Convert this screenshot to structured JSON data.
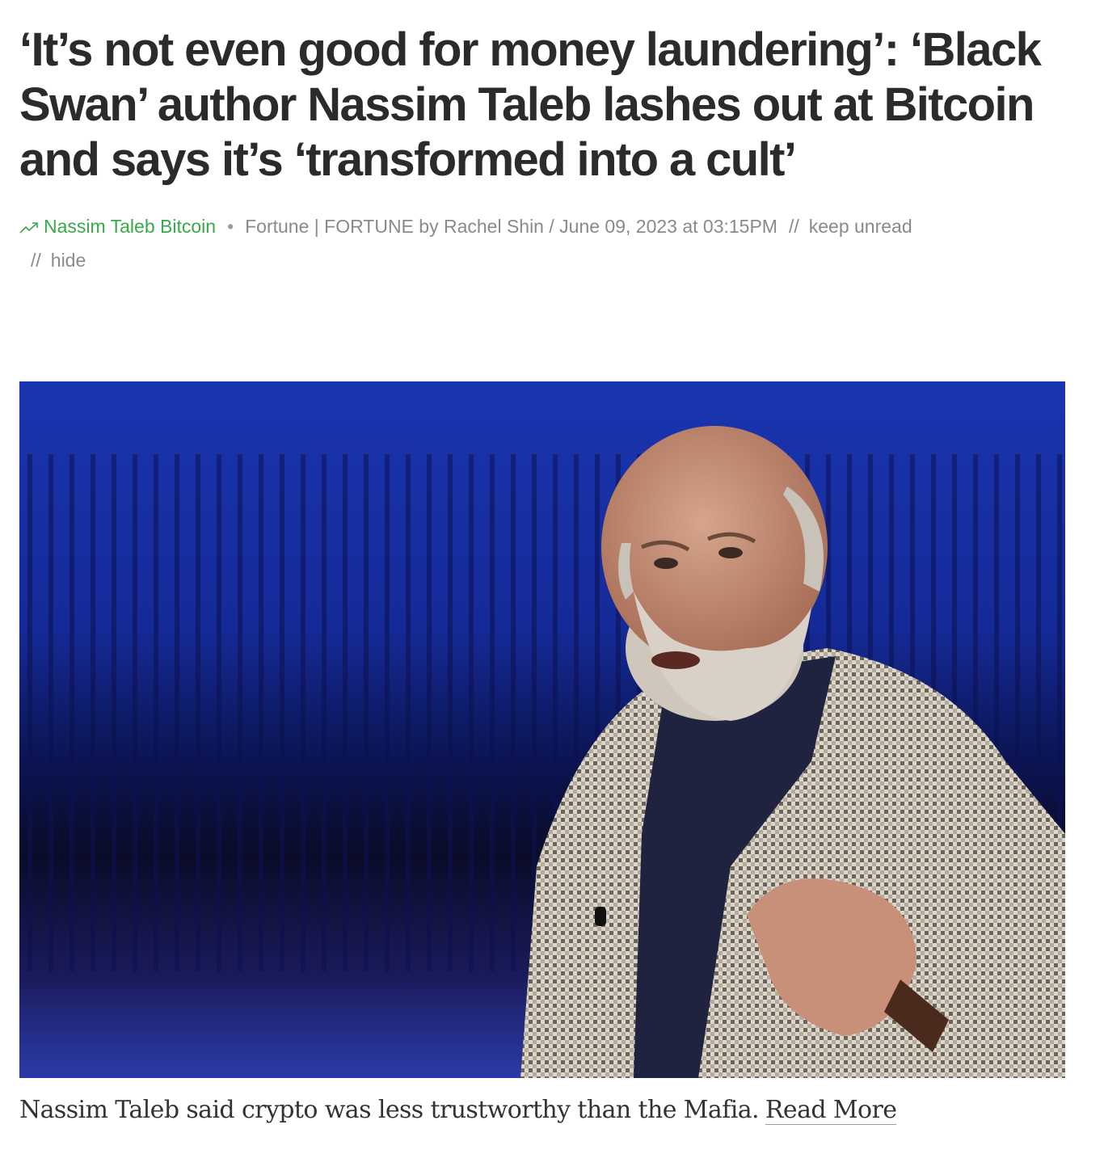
{
  "article": {
    "headline": "‘It’s not even good for money laundering’: ‘Black Swan’ author Nassim Taleb lashes out at Bitcoin and says it’s ‘transformed into a cult’",
    "meta": {
      "trend_icon": "trending-up-icon",
      "topic": "Nassim Taleb Bitcoin",
      "bullet": "•",
      "source": "Fortune | FORTUNE by Rachel Shin / June 09, 2023 at 03:15PM",
      "separator": "//",
      "keep_unread": "keep unread",
      "hide": "hide"
    },
    "image": {
      "icon": "article-photo",
      "background_color": "#1530a8"
    },
    "caption": {
      "text": "Nassim Taleb said crypto was less trustworthy than the Mafia.",
      "read_more": "Read More"
    }
  },
  "colors": {
    "headline": "#2b2b2b",
    "topic_link": "#3aa84a",
    "meta_text": "#8a8a8a"
  }
}
